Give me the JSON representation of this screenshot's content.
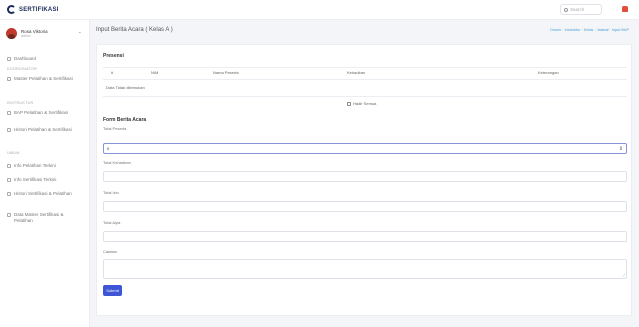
{
  "app": {
    "brand": "SERTIFIKASI",
    "logo_icon": "brand-logo-icon"
  },
  "search": {
    "placeholder": "Search"
  },
  "user": {
    "name": "Rosa Viktoria",
    "role": "admin"
  },
  "sidebar": {
    "dashboard": "Dashboard",
    "sections": [
      {
        "header": "KOORDINATOR",
        "items": [
          "Master Pelatihan & Sertifikasi"
        ]
      },
      {
        "header": "INSTRUKTUR",
        "items": [
          "BAP Pelatihan & Sertifikasi",
          "Histori Pelatihan & Sertifikasi"
        ]
      },
      {
        "header": "UMUM",
        "items": [
          "Info Pelatihan Terkini",
          "Info Sertifikasi Terkini",
          "Histori Sertifikasi & Pelatihan",
          "Data Master Sertifikasi & Pelatihan"
        ]
      }
    ]
  },
  "page": {
    "title": "Input Berita Acara ( Kelas A )",
    "breadcrumb": "Dosen · Instruktur · Kelas · Jadwal · Input BAP"
  },
  "presensi": {
    "title": "Presensi",
    "columns": [
      "#",
      "NIM",
      "Nama Peserta",
      "Kehadiran",
      "Keterangan"
    ],
    "empty_text": "Data Tidak ditemukan",
    "check_all_label": "Hadir Semua"
  },
  "form": {
    "title": "Form Berita Acara",
    "fields": [
      {
        "label": "Total Peserta",
        "value": "0"
      },
      {
        "label": "Total Kehadiran",
        "value": ""
      },
      {
        "label": "Total Izin",
        "value": ""
      },
      {
        "label": "Total Alpa",
        "value": ""
      },
      {
        "label": "Catatan",
        "value": ""
      }
    ],
    "submit_label": "Submit"
  },
  "colors": {
    "accent": "#3e56d6",
    "brand": "#1c2c5a",
    "link": "#4a9fd8"
  }
}
